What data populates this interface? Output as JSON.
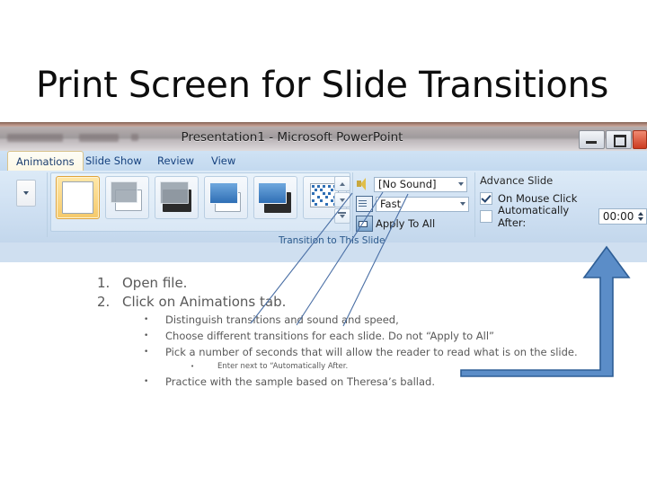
{
  "slide": {
    "title": "Print Screen for Slide Transitions"
  },
  "screenshot": {
    "window_title": "Presentation1 - Microsoft PowerPoint",
    "window_controls": [
      {
        "name": "minimize",
        "glyph": "minimize-icon"
      },
      {
        "name": "restore",
        "glyph": "restore-icon"
      },
      {
        "name": "close",
        "glyph": "close-icon"
      }
    ],
    "tabs": [
      {
        "label": "Animations",
        "active": true
      },
      {
        "label": "Slide Show",
        "active": false
      },
      {
        "label": "Review",
        "active": false
      },
      {
        "label": "View",
        "active": false
      }
    ],
    "group_label": "Transition to This Slide",
    "gallery": {
      "items": [
        {
          "name": "no-transition",
          "selected": true
        },
        {
          "name": "blinds-fade",
          "selected": false
        },
        {
          "name": "fade-through-black",
          "selected": false
        },
        {
          "name": "push-down",
          "selected": false
        },
        {
          "name": "wipe-left",
          "selected": false
        },
        {
          "name": "dissolve",
          "selected": false
        }
      ],
      "scroll_buttons": [
        "scroll-up-icon",
        "scroll-down-icon",
        "more-transitions-icon"
      ]
    },
    "controls": {
      "sound_label": "[No Sound]",
      "speed_label": "Fast",
      "apply_to_all_label": "Apply To All"
    },
    "advance": {
      "heading": "Advance Slide",
      "on_mouse_click_label": "On Mouse Click",
      "on_mouse_click_checked": true,
      "automatically_after_label": "Automatically After:",
      "automatically_after_checked": false,
      "time_value": "00:00"
    }
  },
  "body": {
    "numbered": [
      {
        "num": "1.",
        "text": "Open file."
      },
      {
        "num": "2.",
        "text": "Click on Animations tab."
      }
    ],
    "sub_bullets": [
      "Distinguish transitions and  sound and speed,",
      "Choose different transitions for each slide. Do not “Apply to All”",
      "Pick a number of seconds that will allow the reader to read what is on the slide."
    ],
    "sub_sub_bullet": "Enter next to “Automatically After.",
    "last_bullet": "Practice with the sample based on Theresa’s ballad.",
    "bullet_glyph": "•"
  },
  "shapes": {
    "callout_lines": 3,
    "line_color": "#4a6fa5",
    "arrow_fill": "#5b8dc8",
    "arrow_stroke": "#2e5e96"
  }
}
